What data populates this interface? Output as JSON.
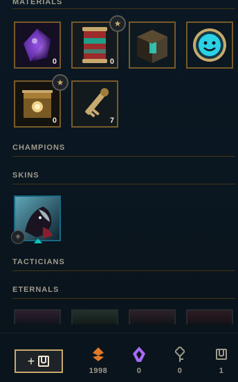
{
  "sections": {
    "materials": "MATERIALS",
    "champions": "CHAMPIONS",
    "skins": "SKINS",
    "tacticians": "TACTICIANS",
    "eternals": "ETERNALS"
  },
  "materials": [
    {
      "name": "gemstone",
      "count": "0",
      "star": false
    },
    {
      "name": "capsule",
      "count": "0",
      "star": true
    },
    {
      "name": "hextech-chest",
      "count": "",
      "star": false
    },
    {
      "name": "emote-orb",
      "count": "",
      "star": false
    },
    {
      "name": "masterwork-chest",
      "count": "0",
      "star": true
    },
    {
      "name": "key-fragment",
      "count": "7",
      "star": false
    }
  ],
  "star_glyph": "★",
  "skins": [
    {
      "name": "skin-shard",
      "rarity_glyph": "⚜"
    }
  ],
  "footer": {
    "craft_label": "+",
    "currencies": [
      {
        "name": "orange-essence",
        "value": "1998",
        "color": "#e07a2a"
      },
      {
        "name": "mythic-essence",
        "value": "0",
        "color": "#a86cf5"
      },
      {
        "name": "key",
        "value": "0",
        "color": "#a09b8c"
      },
      {
        "name": "chest",
        "value": "1",
        "color": "#a09b8c"
      }
    ]
  },
  "colors": {
    "gold": "#c8aa6e",
    "border_gold": "#785a28",
    "divider": "#463714",
    "text": "#a09b8c",
    "bg": "#0a1520"
  }
}
